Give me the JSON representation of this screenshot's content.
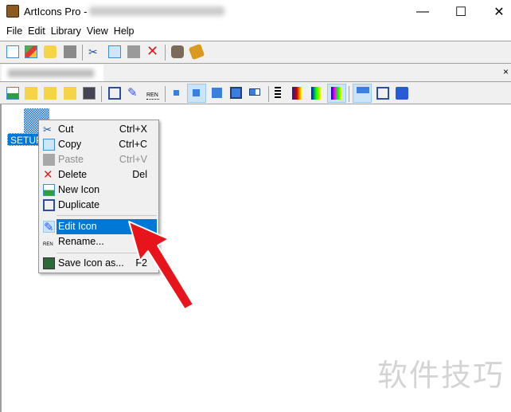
{
  "window": {
    "title": "ArtIcons Pro -",
    "controls": {
      "minimize": "—",
      "maximize": "☐",
      "close": "✕"
    }
  },
  "menubar": [
    "File",
    "Edit",
    "Library",
    "View",
    "Help"
  ],
  "toolbar1": [
    "new-file-icon",
    "new-library-icon",
    "open-icon",
    "save-icon",
    "cut-icon",
    "copy-icon",
    "paste-icon",
    "delete-icon",
    "wizard-icon",
    "help-book-icon"
  ],
  "toolbar2": [
    "new-icon-icon",
    "folder-add-icon",
    "folder-add-2-icon",
    "folder-add-3-icon",
    "import-icon",
    "duplicate-icon",
    "edit-icon",
    "rename-icon",
    "size-tiny-icon",
    "size-small-icon",
    "size-medium-icon",
    "size-large-icon",
    "size-mixed-icon",
    "color-mono-icon",
    "color-16-icon",
    "color-256-icon",
    "color-true-icon",
    "view-icon-icon",
    "fit-icon",
    "preview-icon"
  ],
  "tab": {
    "close": "×"
  },
  "item": {
    "label": "SETUP"
  },
  "context_menu": {
    "items": [
      {
        "label": "Cut",
        "shortcut": "Ctrl+X"
      },
      {
        "label": "Copy",
        "shortcut": "Ctrl+C"
      },
      {
        "label": "Paste",
        "shortcut": "Ctrl+V",
        "disabled": true
      },
      {
        "label": "Delete",
        "shortcut": "Del"
      },
      {
        "label": "New Icon",
        "shortcut": ""
      },
      {
        "label": "Duplicate",
        "shortcut": ""
      },
      {
        "label": "Edit Icon",
        "shortcut": "",
        "highlighted": true
      },
      {
        "label": "Rename...",
        "shortcut": ""
      },
      {
        "label": "Save Icon as...",
        "shortcut": "F2"
      }
    ]
  },
  "colors": {
    "highlight": "#0078d7",
    "arrow": "#e8141b"
  },
  "watermark": "软件技巧"
}
